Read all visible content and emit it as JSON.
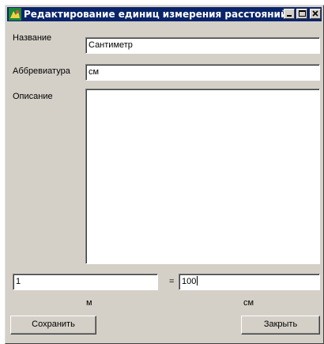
{
  "window": {
    "title": "Редактирование единиц измерения расстояний"
  },
  "form": {
    "name_label": "Название",
    "name_value": "Сантиметр",
    "abbr_label": "Аббревиатура",
    "abbr_value": "см",
    "description_label": "Описание",
    "description_value": ""
  },
  "conversion": {
    "left_value": "1",
    "equals": "=",
    "right_value": "100",
    "left_unit": "м",
    "right_unit": "см"
  },
  "buttons": {
    "save": "Сохранить",
    "close": "Закрыть"
  }
}
